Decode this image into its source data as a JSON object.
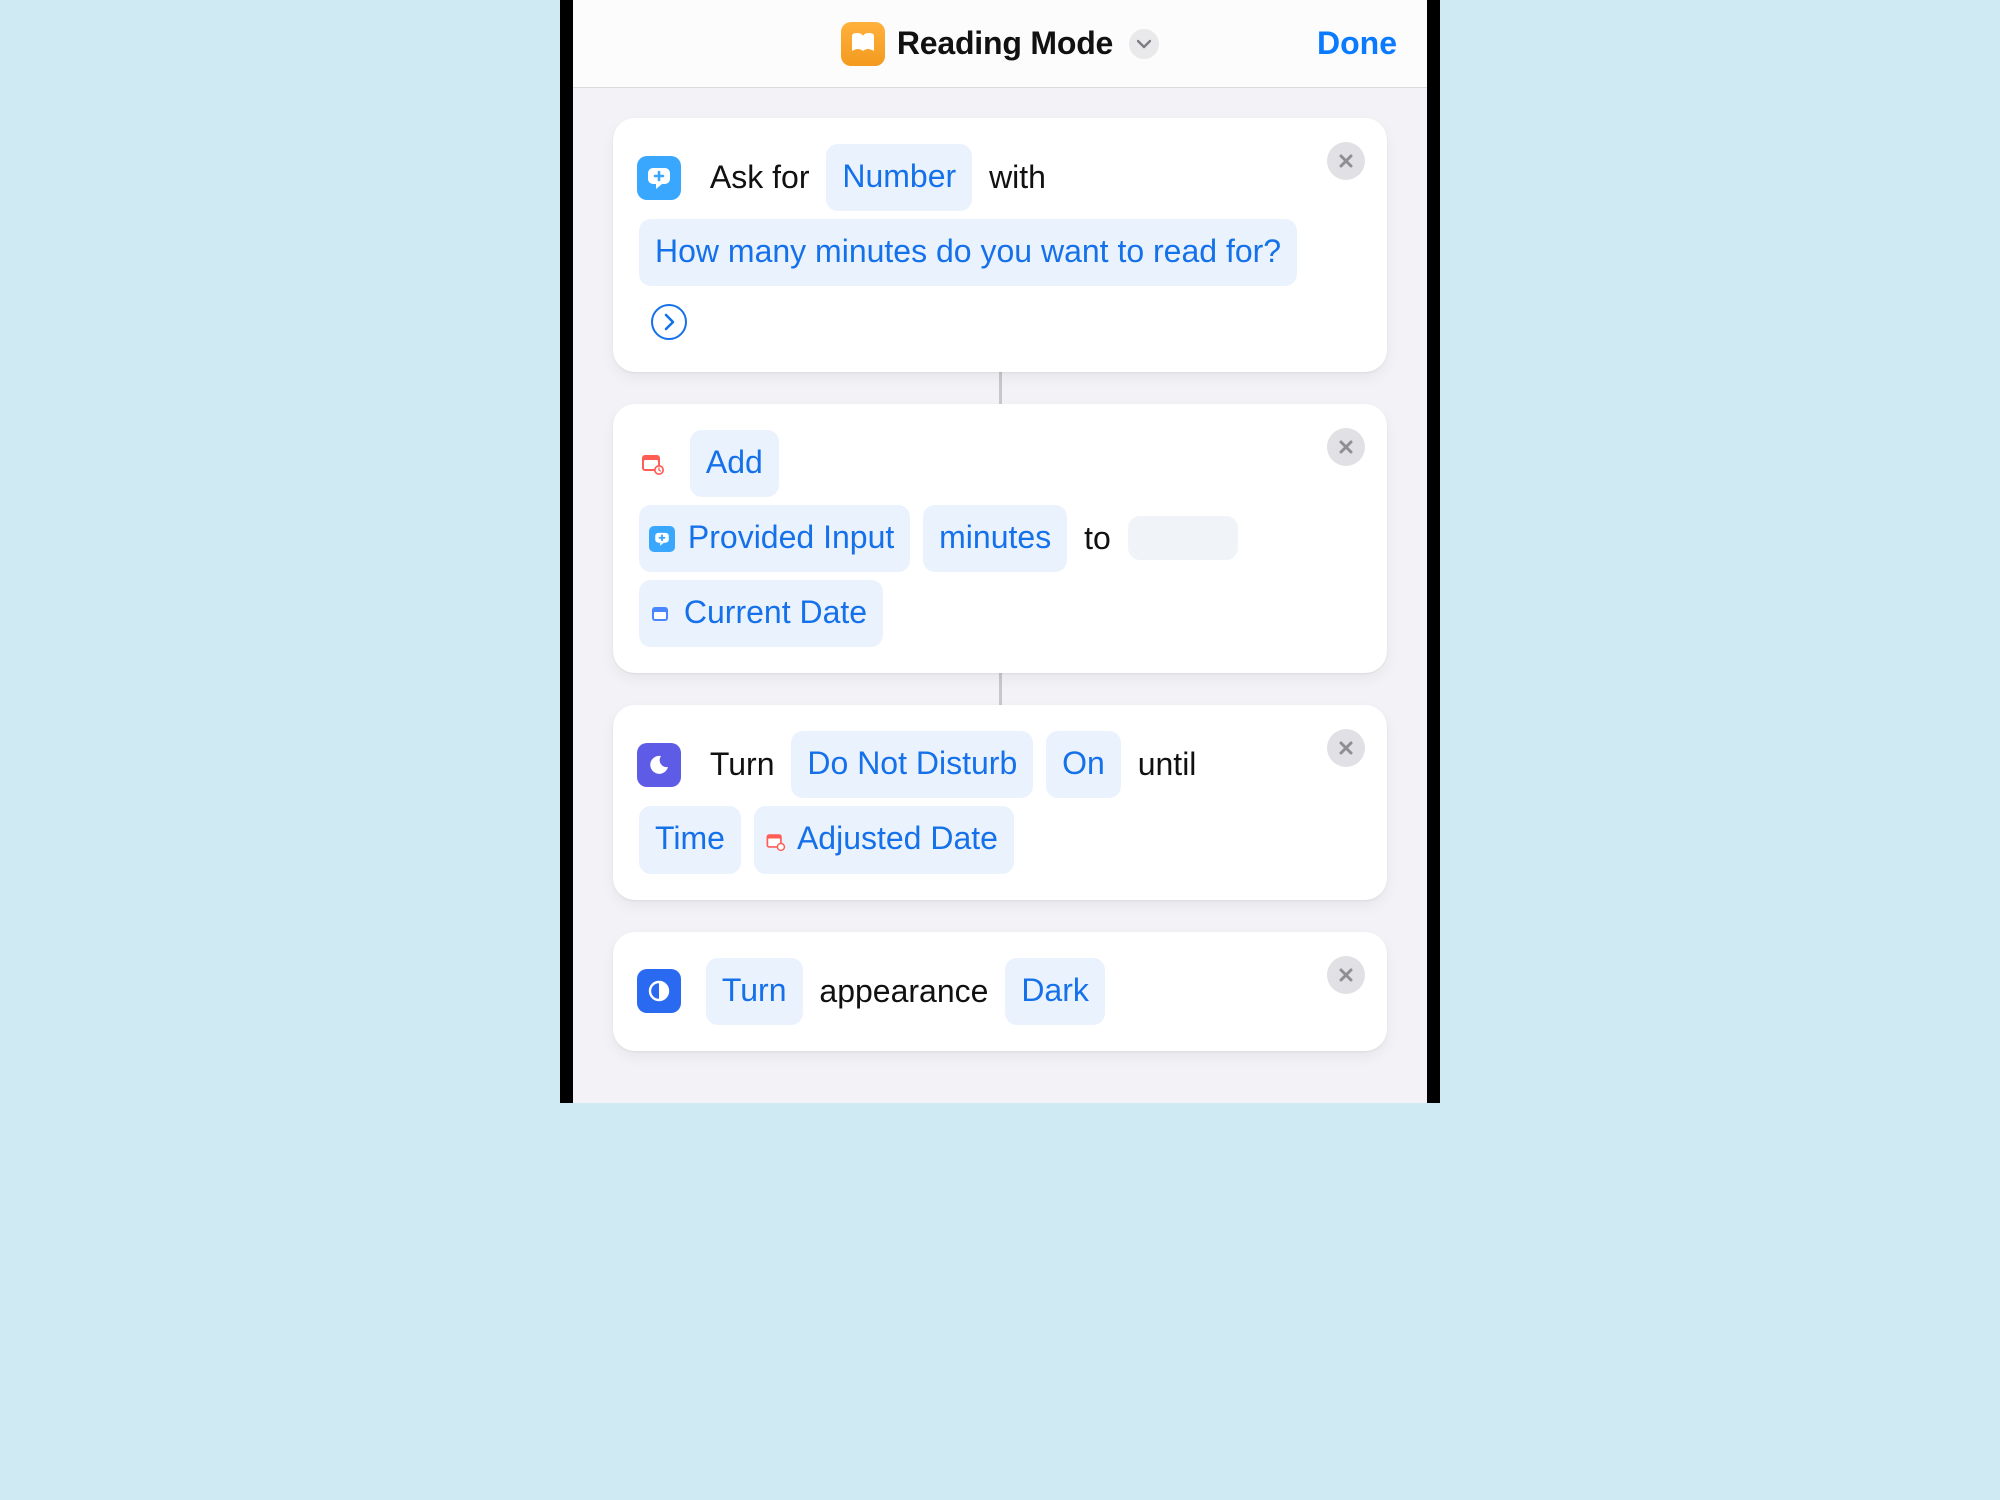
{
  "header": {
    "title": "Reading Mode",
    "done_label": "Done"
  },
  "actions": {
    "ask": {
      "prefix": "Ask for",
      "type_token": "Number",
      "with": "with",
      "prompt": "How many minutes do you want to read for?"
    },
    "add": {
      "verb": "Add",
      "input_token": "Provided Input",
      "unit_token": "minutes",
      "to": "to",
      "target_token": "Current Date"
    },
    "dnd": {
      "prefix": "Turn",
      "focus_token": "Do Not Disturb",
      "state_token": "On",
      "until": "until",
      "time_token": "Time",
      "date_token": "Adjusted Date"
    },
    "appearance": {
      "verb": "Turn",
      "label": "appearance",
      "mode_token": "Dark"
    }
  }
}
